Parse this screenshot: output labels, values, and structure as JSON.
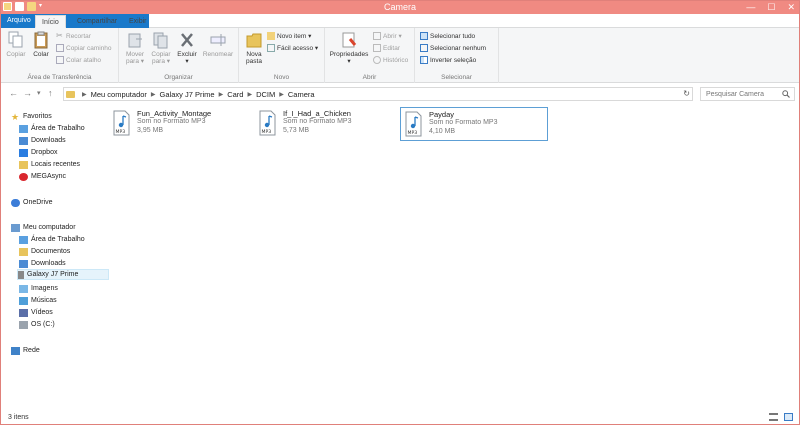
{
  "window": {
    "title": "Camera",
    "controls": {
      "minimize": "—",
      "maximize": "☐",
      "close": "✕"
    }
  },
  "tabs": [
    {
      "label": "Arquivo"
    },
    {
      "label": "Início"
    },
    {
      "label": "Compartilhar"
    },
    {
      "label": "Exibir"
    }
  ],
  "ribbon": {
    "clipboard": {
      "name": "Área de Transferência",
      "copy": "Copiar",
      "paste": "Colar",
      "cut": "Recortar",
      "copy_path": "Copiar caminho",
      "paste_shortcut": "Colar atalho"
    },
    "organize": {
      "name": "Organizar",
      "move_to_1": "Mover",
      "move_to_2": "para ▾",
      "copy_to_1": "Copiar",
      "copy_to_2": "para ▾",
      "delete_1": "Excluir",
      "delete_2": "▾",
      "rename": "Renomear"
    },
    "new": {
      "name": "Novo",
      "new_folder_1": "Nova",
      "new_folder_2": "pasta",
      "new_item": "Novo item ▾",
      "easy_access": "Fácil acesso ▾"
    },
    "open": {
      "name": "Abrir",
      "properties_1": "Propriedades",
      "properties_2": "▾",
      "open": "Abrir ▾",
      "edit": "Editar",
      "history": "Histórico"
    },
    "select": {
      "name": "Selecionar",
      "select_all": "Selecionar tudo",
      "select_none": "Selecionar nenhum",
      "invert": "Inverter seleção"
    }
  },
  "address": {
    "back": "←",
    "forward": "→",
    "recent": "▾",
    "up": "↑",
    "crumbs": [
      "Meu computador",
      "Galaxy J7 Prime",
      "Card",
      "DCIM",
      "Camera"
    ],
    "refresh": "↻",
    "search_placeholder": "Pesquisar Camera"
  },
  "nav": {
    "favorites": "Favoritos",
    "fav_items": [
      "Área de Trabalho",
      "Downloads",
      "Dropbox",
      "Locais recentes",
      "MEGAsync"
    ],
    "onedrive": "OneDrive",
    "computer": "Meu computador",
    "computer_items": [
      "Área de Trabalho",
      "Documentos",
      "Downloads",
      "Galaxy J7 Prime",
      "Imagens",
      "Músicas",
      "Vídeos",
      "OS (C:)"
    ],
    "network": "Rede"
  },
  "files": [
    {
      "name": "Fun_Activity_Montage",
      "type": "Som no Formato MP3",
      "size": "3,95 MB",
      "icon_label": "MP3"
    },
    {
      "name": "If_I_Had_a_Chicken",
      "type": "Som no Formato MP3",
      "size": "5,73 MB",
      "icon_label": "MP3"
    },
    {
      "name": "Payday",
      "type": "Som no Formato MP3",
      "size": "4,10 MB",
      "icon_label": "MP3"
    }
  ],
  "status": {
    "count": "3 itens"
  },
  "colors": {
    "titlebar": "#f08a82",
    "file_tab": "#1979ca",
    "folder": "#e8c45c",
    "selection": "#5d9fd5"
  }
}
